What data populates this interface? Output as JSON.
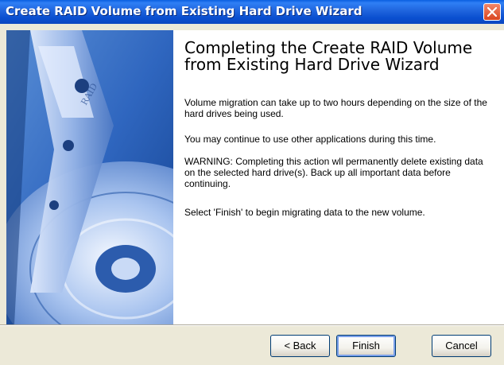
{
  "window": {
    "title": "Create RAID Volume from Existing Hard Drive Wizard"
  },
  "content": {
    "heading": "Completing the Create RAID Volume from Existing Hard Drive Wizard",
    "paragraphs": [
      "Volume migration can take up to two hours depending on the size of the hard drives being used.",
      "You may continue to use other applications during this time.",
      "WARNING: Completing this action wll permanently delete existing data on the selected hard drive(s). Back up all important data before continuing.",
      "Select 'Finish' to begin migrating data to the new volume."
    ]
  },
  "buttons": {
    "back": "< Back",
    "finish": "Finish",
    "cancel": "Cancel"
  },
  "icons": {
    "close": "close-icon",
    "banner": "hard-drive-image"
  },
  "colors": {
    "titlebar": "#0a4fd0",
    "close_button": "#d9451f",
    "window_bg": "#ece9d8",
    "banner_blue": "#1b4f9e"
  }
}
